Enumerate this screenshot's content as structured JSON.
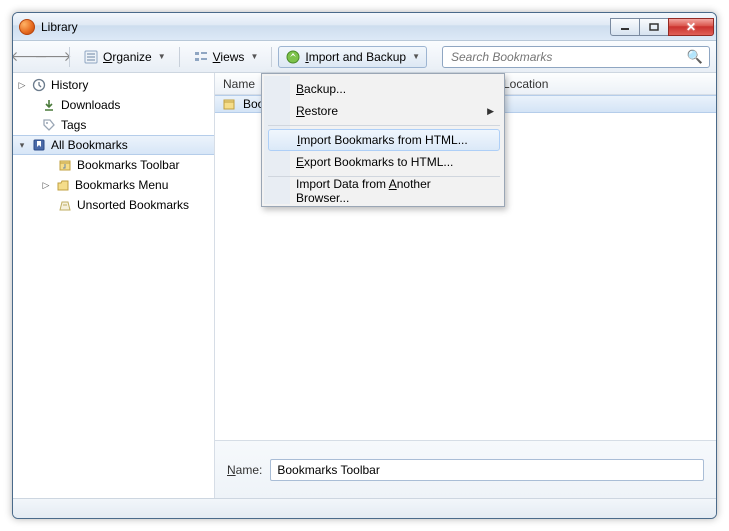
{
  "window": {
    "title": "Library"
  },
  "toolbar": {
    "organize_label": "Organize",
    "views_label": "Views",
    "import_label": "Import and Backup"
  },
  "search": {
    "placeholder": "Search Bookmarks"
  },
  "sidebar": {
    "history": "History",
    "downloads": "Downloads",
    "tags": "Tags",
    "all_bookmarks": "All Bookmarks",
    "toolbar": "Bookmarks Toolbar",
    "menu": "Bookmarks Menu",
    "unsorted": "Unsorted Bookmarks"
  },
  "columns": {
    "name": "Name",
    "location": "Location"
  },
  "list": {
    "row0_name": "Bookmarks Toolbar"
  },
  "details": {
    "name_label": "Name:",
    "name_value": "Bookmarks Toolbar"
  },
  "menu": {
    "backup": "Backup...",
    "restore": "Restore",
    "import_html": "Import Bookmarks from HTML...",
    "export_html": "Export Bookmarks to HTML...",
    "import_browser": "Import Data from Another Browser..."
  }
}
